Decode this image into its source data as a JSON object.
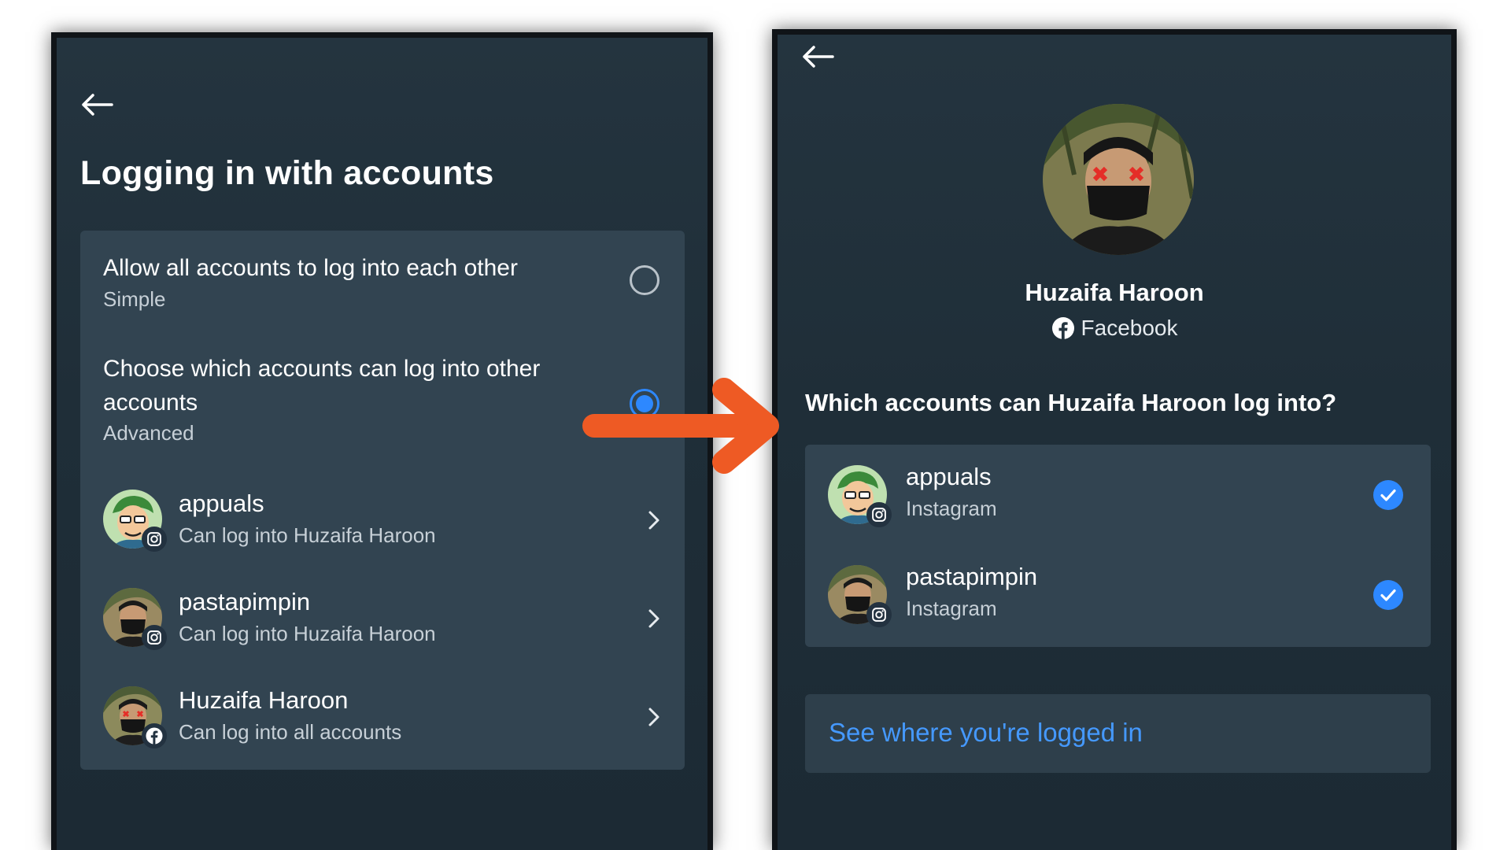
{
  "colors": {
    "background": "#1f2e38",
    "card": "#324451",
    "accent_blue": "#2d88ff",
    "link_blue": "#4599ff",
    "arrow_orange": "#ee5a24"
  },
  "left_screen": {
    "title": "Logging in with accounts",
    "back_icon": "arrow-left-icon",
    "options": [
      {
        "title": "Allow all accounts to log into each other",
        "subtitle": "Simple",
        "selected": false
      },
      {
        "title": "Choose which accounts can log into other accounts",
        "subtitle": "Advanced",
        "selected": true
      }
    ],
    "accounts": [
      {
        "name": "appuals",
        "status": "Can log into Huzaifa Haroon",
        "platform_icon": "instagram-icon"
      },
      {
        "name": "pastapimpin",
        "status": "Can log into Huzaifa Haroon",
        "platform_icon": "instagram-icon"
      },
      {
        "name": "Huzaifa Haroon",
        "status": "Can log into all accounts",
        "platform_icon": "facebook-icon"
      }
    ]
  },
  "right_screen": {
    "back_icon": "arrow-left-icon",
    "profile": {
      "name": "Huzaifa Haroon",
      "platform": "Facebook"
    },
    "question": "Which accounts can Huzaifa Haroon log into?",
    "accounts": [
      {
        "name": "appuals",
        "platform": "Instagram",
        "checked": true
      },
      {
        "name": "pastapimpin",
        "platform": "Instagram",
        "checked": true
      }
    ],
    "link_label": "See where you're logged in"
  }
}
